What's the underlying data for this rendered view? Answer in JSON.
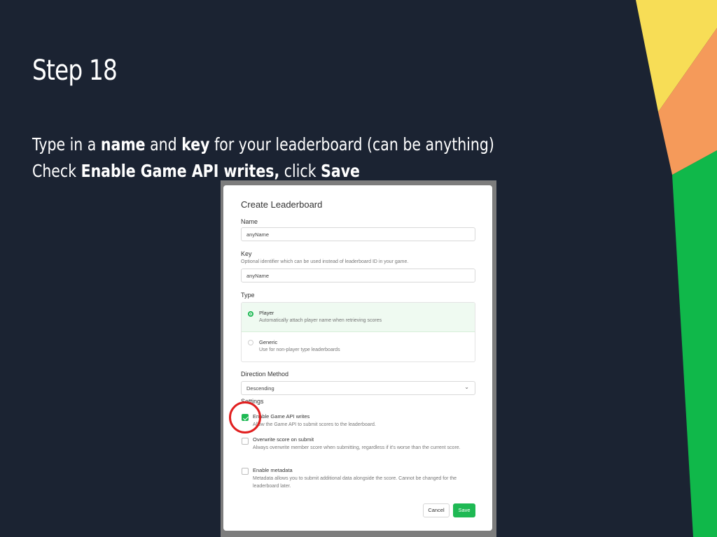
{
  "slide": {
    "title": "Step 18",
    "line1": {
      "t1": "Type in a ",
      "b1": "name",
      "t2": " and ",
      "b2": "key",
      "t3": " for your leaderboard (can be anything)"
    },
    "line2": {
      "t1": "Check ",
      "b1": "Enable Game API writes,",
      "t2": " click ",
      "b2": "Save"
    }
  },
  "colors": {
    "background": "#1b2332",
    "accent_green": "#1fb954",
    "accent_red": "#e11f1f",
    "deco_yellow": "#f7dd56",
    "deco_orange": "#f59a5a",
    "deco_green": "#10b84a"
  },
  "modal": {
    "title": "Create Leaderboard",
    "name_label": "Name",
    "name_value": "anyName",
    "key_label": "Key",
    "key_hint": "Optional identifier which can be used instead of leaderboard ID in your game.",
    "key_value": "anyName",
    "type_label": "Type",
    "types": [
      {
        "name": "Player",
        "desc": "Automatically attach player name when retrieving scores",
        "selected": true
      },
      {
        "name": "Generic",
        "desc": "Use for non-player type leaderboards",
        "selected": false
      }
    ],
    "direction_label": "Direction Method",
    "direction_value": "Descending",
    "settings_label": "Settings",
    "options": [
      {
        "name": "Enable Game API writes",
        "desc": "Allow the Game API to submit scores to the leaderboard.",
        "checked": true
      },
      {
        "name": "Overwrite score on submit",
        "desc": "Always overwrite member score when submitting, regardless if it's worse than the current score.",
        "checked": false
      },
      {
        "name": "Enable metadata",
        "desc": "Metadata allows you to submit additional data alongside the score. Cannot be changed for the leaderboard later.",
        "checked": false
      }
    ],
    "cancel_label": "Cancel",
    "save_label": "Save"
  }
}
